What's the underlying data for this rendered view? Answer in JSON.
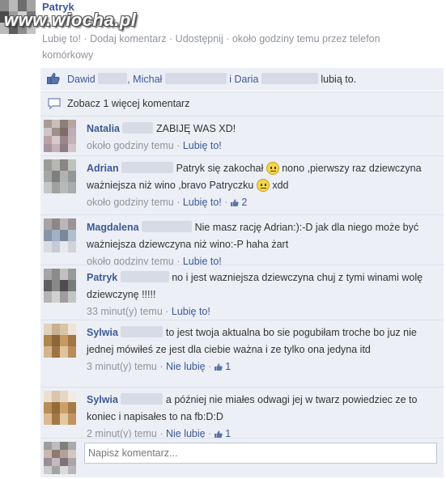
{
  "post": {
    "author": "Patryk",
    "actions_line": "Lubię to! · Dodaj komentarz · Udostępnij · około godziny temu przez telefon komórkowy"
  },
  "watermark": "www.wiocha.pl",
  "likes": {
    "names": [
      "Dawid",
      ", Michał",
      " i Daria"
    ],
    "suffix": "lubią to."
  },
  "see_more": "Zobacz 1 więcej komentarz",
  "comments": [
    {
      "name": "Natalia",
      "text": "ZABIJĘ WAS XD!",
      "time": "około godziny temu",
      "like": "Lubię to!",
      "count": ""
    },
    {
      "name": "Adrian",
      "text_1": "Patryk się zakochał",
      "text_2": "nono ,pierwszy raz dziewczyna ważniejsza niż wino ,bravo Patryczku",
      "text_3": "xdd",
      "time": "około godziny temu",
      "like": "Lubię to!",
      "count": "2"
    },
    {
      "name": "Magdalena",
      "text": "Nie masz rację Adrian:):-D jak dla niego może być ważniejsza dziewczyna niż wino:-P haha żart",
      "time": "około godziny temu",
      "like": "Lubię to!",
      "count": ""
    },
    {
      "name": "Patryk",
      "text": "no i jest wazniejsza dziewczyna chuj z tymi winami wolę dziewczynę !!!!!",
      "time": "33 minut(y) temu",
      "like": "Lubię to!",
      "count": ""
    },
    {
      "name": "Sylwia",
      "text": "to jest twoja aktualna bo sie pogubiłam troche bo juz nie jednej mówiłeś ze jest dla ciebie ważna i ze tylko ona jedyna itd",
      "time": "3 minut(y) temu",
      "like": "Nie lubię",
      "count": "1"
    },
    {
      "name": "Sylwia",
      "text": "a później nie miałes odwagi jej w twarz powiedziec ze to koniec i napisałes to na fb:D:D",
      "time": "2 minut(y) temu",
      "like": "Nie lubię",
      "count": "1"
    }
  ],
  "comment_input": {
    "placeholder": "Napisz komentarz..."
  },
  "colors": {
    "link": "#3b5998",
    "panel": "#eceff5",
    "meta": "#90949c"
  }
}
